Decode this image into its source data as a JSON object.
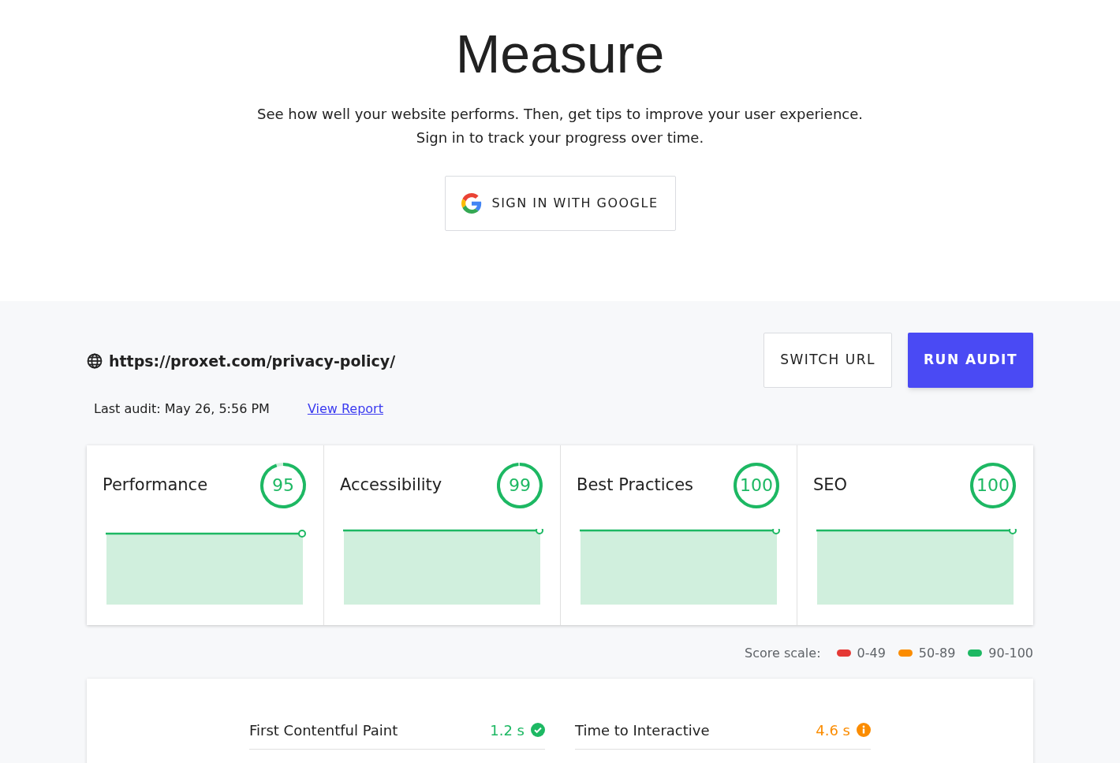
{
  "header": {
    "title": "Measure",
    "subtitle_lines": [
      "See how well your website performs. Then, get tips to improve your user experience.",
      "Sign in to track your progress over time."
    ],
    "sign_in_button": "SIGN IN WITH GOOGLE"
  },
  "audit": {
    "url": "https://proxet.com/privacy-policy/",
    "last_audit": "Last audit: May 26, 5:56 PM",
    "view_report_link": "View Report",
    "buttons": [
      {
        "label": "SWITCH URL",
        "kind": "outline"
      },
      {
        "label": "RUN AUDIT",
        "kind": "primary"
      }
    ]
  },
  "categories": [
    {
      "name": "Performance",
      "score": "95",
      "level": 0.95
    },
    {
      "name": "Accessibility",
      "score": "99",
      "level": 0.99
    },
    {
      "name": "Best Practices",
      "score": "100",
      "level": 1
    },
    {
      "name": "SEO",
      "score": "100",
      "level": 1
    }
  ],
  "score_scale": {
    "label": "Score scale:",
    "items": [
      {
        "range": "0-49",
        "color": "#e53935"
      },
      {
        "range": "50-89",
        "color": "#fb8c00"
      },
      {
        "range": "90-100",
        "color": "#1db863"
      }
    ]
  },
  "metrics": [
    {
      "name": "First Contentful Paint",
      "value": "1.2 s",
      "kind": "good"
    },
    {
      "name": "Time to Interactive",
      "value": "4.6 s",
      "kind": "average"
    }
  ]
}
